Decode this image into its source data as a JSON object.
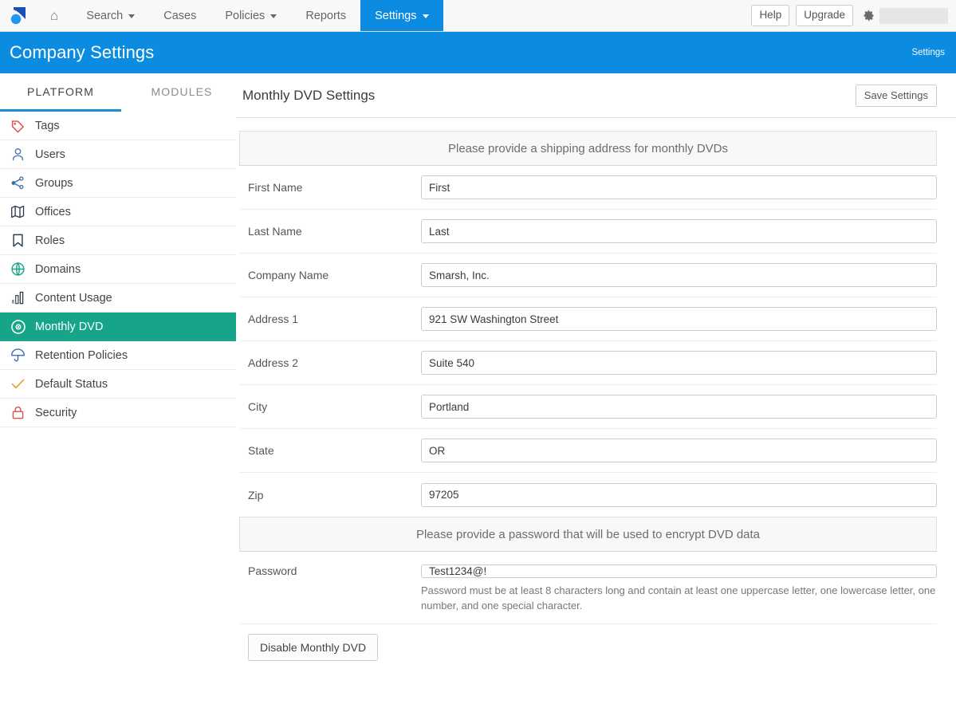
{
  "navbar": {
    "logo_name": "smarsh-logo",
    "home_label": "⌂",
    "items": [
      {
        "label": "Search",
        "caret": true,
        "active": false
      },
      {
        "label": "Cases",
        "caret": false,
        "active": false
      },
      {
        "label": "Policies",
        "caret": true,
        "active": false
      },
      {
        "label": "Reports",
        "caret": false,
        "active": false
      },
      {
        "label": "Settings",
        "caret": true,
        "active": true
      }
    ],
    "help_label": "Help",
    "upgrade_label": "Upgrade",
    "account_redacted": ""
  },
  "page_header": {
    "title": "Company Settings",
    "breadcrumb": "Settings",
    "accent_color": "#0c8ce0"
  },
  "sidebar": {
    "tabs": [
      {
        "label": "PLATFORM",
        "active": true
      },
      {
        "label": "MODULES",
        "active": false
      }
    ],
    "active_color": "#17a589",
    "items": [
      {
        "label": "Tags",
        "icon": "tag-icon",
        "active": false
      },
      {
        "label": "Users",
        "icon": "user-icon",
        "active": false
      },
      {
        "label": "Groups",
        "icon": "share-nodes-icon",
        "active": false
      },
      {
        "label": "Offices",
        "icon": "map-icon",
        "active": false
      },
      {
        "label": "Roles",
        "icon": "bookmark-icon",
        "active": false
      },
      {
        "label": "Domains",
        "icon": "globe-icon",
        "active": false
      },
      {
        "label": "Content Usage",
        "icon": "bar-chart-icon",
        "active": false
      },
      {
        "label": "Monthly DVD",
        "icon": "disc-icon",
        "active": true
      },
      {
        "label": "Retention Policies",
        "icon": "umbrella-icon",
        "active": false
      },
      {
        "label": "Default Status",
        "icon": "check-icon",
        "active": false
      },
      {
        "label": "Security",
        "icon": "lock-icon",
        "active": false
      }
    ]
  },
  "main": {
    "title": "Monthly DVD Settings",
    "save_label": "Save Settings",
    "address_section": {
      "heading": "Please provide a shipping address for monthly DVDs",
      "fields": [
        {
          "label": "First Name",
          "value": "First"
        },
        {
          "label": "Last Name",
          "value": "Last"
        },
        {
          "label": "Company Name",
          "value": "Smarsh, Inc."
        },
        {
          "label": "Address 1",
          "value": "921 SW Washington Street"
        },
        {
          "label": "Address 2",
          "value": "Suite 540"
        },
        {
          "label": "City",
          "value": "Portland"
        },
        {
          "label": "State",
          "value": "OR"
        },
        {
          "label": "Zip",
          "value": "97205"
        }
      ]
    },
    "password_section": {
      "heading": "Please provide a password that will be used to encrypt DVD data",
      "label": "Password",
      "value": "Test1234@!",
      "help": "Password must be at least 8 characters long and contain at least one uppercase letter, one lowercase letter, one number, and one special character."
    },
    "disable_label": "Disable Monthly DVD"
  }
}
